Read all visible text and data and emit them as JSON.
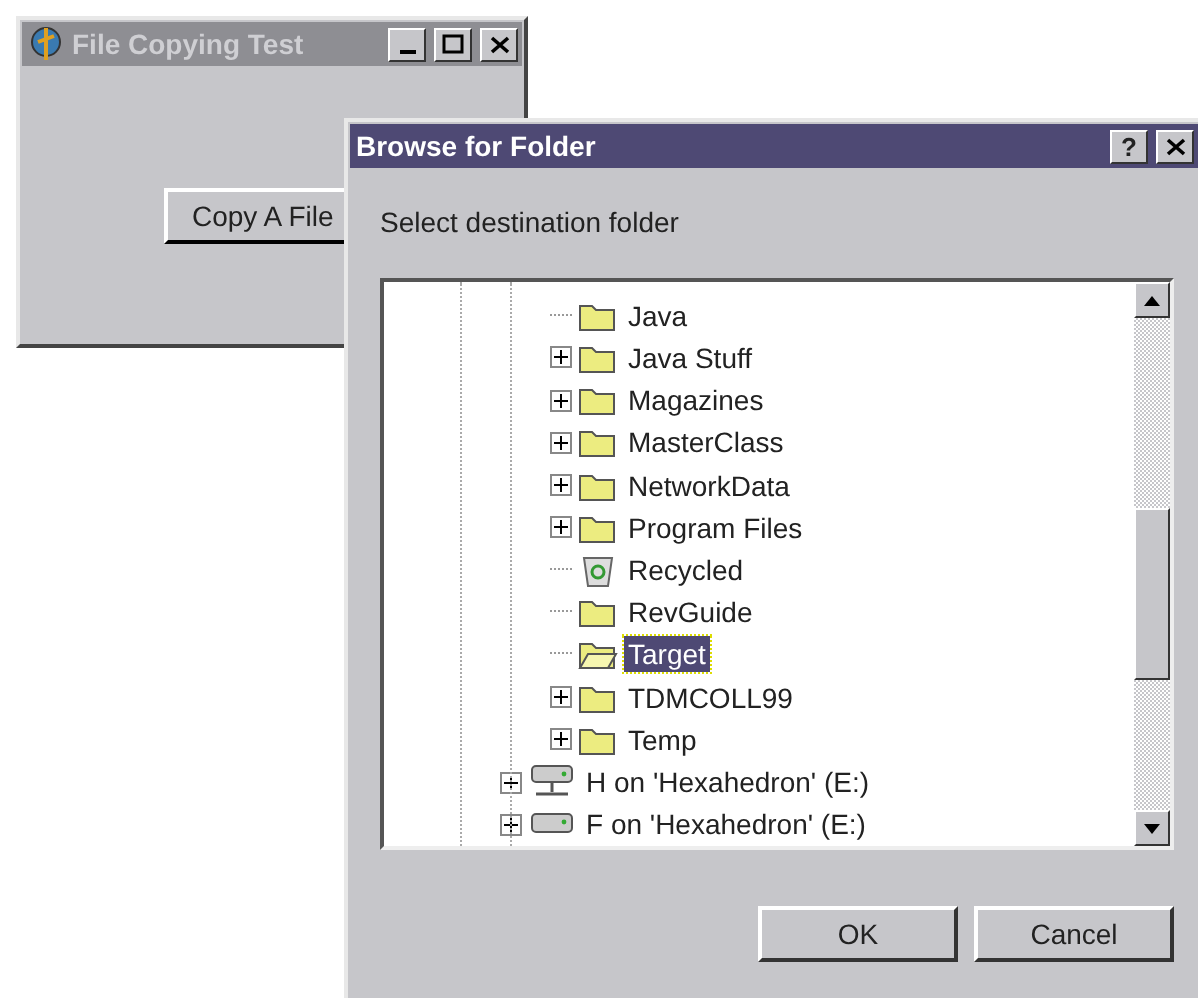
{
  "main_window": {
    "title": "File Copying Test",
    "active": false,
    "button": "Copy A File"
  },
  "dialog": {
    "title": "Browse for Folder",
    "active": true,
    "help": "?",
    "prompt": "Select destination folder",
    "tree": {
      "folders": [
        {
          "label": "Java",
          "kind": "folder",
          "expandable": false,
          "selected": false
        },
        {
          "label": "Java Stuff",
          "kind": "folder",
          "expandable": true,
          "selected": false
        },
        {
          "label": "Magazines",
          "kind": "folder",
          "expandable": true,
          "selected": false
        },
        {
          "label": "MasterClass",
          "kind": "folder",
          "expandable": true,
          "selected": false
        },
        {
          "label": "NetworkData",
          "kind": "folder",
          "expandable": true,
          "selected": false
        },
        {
          "label": "Program Files",
          "kind": "folder",
          "expandable": true,
          "selected": false
        },
        {
          "label": "Recycled",
          "kind": "recycle",
          "expandable": false,
          "selected": false
        },
        {
          "label": "RevGuide",
          "kind": "folder",
          "expandable": false,
          "selected": false
        },
        {
          "label": "Target",
          "kind": "folder",
          "expandable": false,
          "selected": true
        },
        {
          "label": "TDMCOLL99",
          "kind": "folder",
          "expandable": true,
          "selected": false
        },
        {
          "label": "Temp",
          "kind": "folder",
          "expandable": true,
          "selected": false
        }
      ],
      "drives": [
        {
          "label": "H on 'Hexahedron' (E:)",
          "kind": "network-drive",
          "expandable": true,
          "selected": false
        },
        {
          "label": "F on 'Hexahedron' (E:)",
          "kind": "drive",
          "expandable": true,
          "selected": false
        }
      ]
    },
    "buttons": [
      "OK",
      "Cancel"
    ]
  }
}
